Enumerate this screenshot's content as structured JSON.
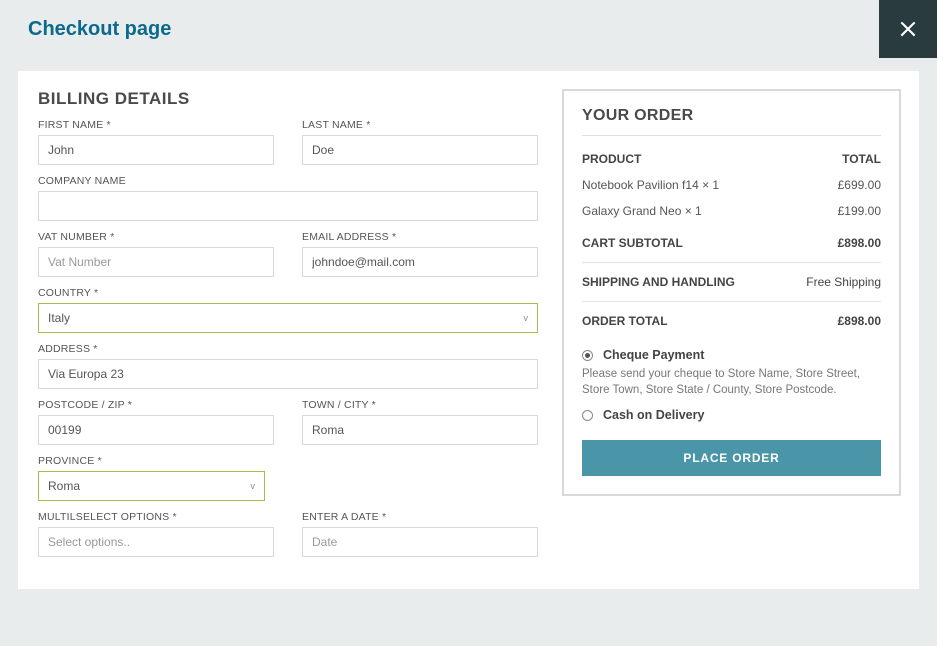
{
  "page_title": "Checkout page",
  "billing": {
    "title": "BILLING DETAILS",
    "first_name": {
      "label": "FIRST NAME *",
      "value": "John"
    },
    "last_name": {
      "label": "LAST NAME *",
      "value": "Doe"
    },
    "company": {
      "label": "COMPANY NAME",
      "value": ""
    },
    "vat": {
      "label": "VAT NUMBER *",
      "placeholder": "Vat Number",
      "value": ""
    },
    "email": {
      "label": "EMAIL ADDRESS *",
      "value": "johndoe@mail.com"
    },
    "country": {
      "label": "COUNTRY *",
      "value": "Italy"
    },
    "address": {
      "label": "ADDRESS *",
      "value": "Via Europa 23"
    },
    "postcode": {
      "label": "POSTCODE / ZIP *",
      "value": "00199"
    },
    "city": {
      "label": "TOWN / CITY *",
      "value": "Roma"
    },
    "province": {
      "label": "PROVINCE *",
      "value": "Roma"
    },
    "multiselect": {
      "label": "MULTILSELECT OPTIONS *",
      "placeholder": "Select options..",
      "value": ""
    },
    "date": {
      "label": "ENTER A DATE *",
      "placeholder": "Date",
      "value": ""
    }
  },
  "order": {
    "title": "YOUR ORDER",
    "head_product": "PRODUCT",
    "head_total": "TOTAL",
    "items": [
      {
        "name": "Notebook Pavilion f14 × 1",
        "price": "£699.00"
      },
      {
        "name": "Galaxy Grand Neo × 1",
        "price": "£199.00"
      }
    ],
    "subtotal_label": "CART SUBTOTAL",
    "subtotal": "£898.00",
    "shipping_label": "SHIPPING AND HANDLING",
    "shipping": "Free Shipping",
    "total_label": "ORDER TOTAL",
    "total": "£898.00",
    "payments": {
      "cheque": {
        "label": "Cheque Payment",
        "desc": "Please send your cheque to Store Name, Store Street, Store Town, Store State / County, Store Postcode."
      },
      "cod": {
        "label": "Cash on Delivery"
      }
    },
    "place_order": "PLACE ORDER"
  }
}
